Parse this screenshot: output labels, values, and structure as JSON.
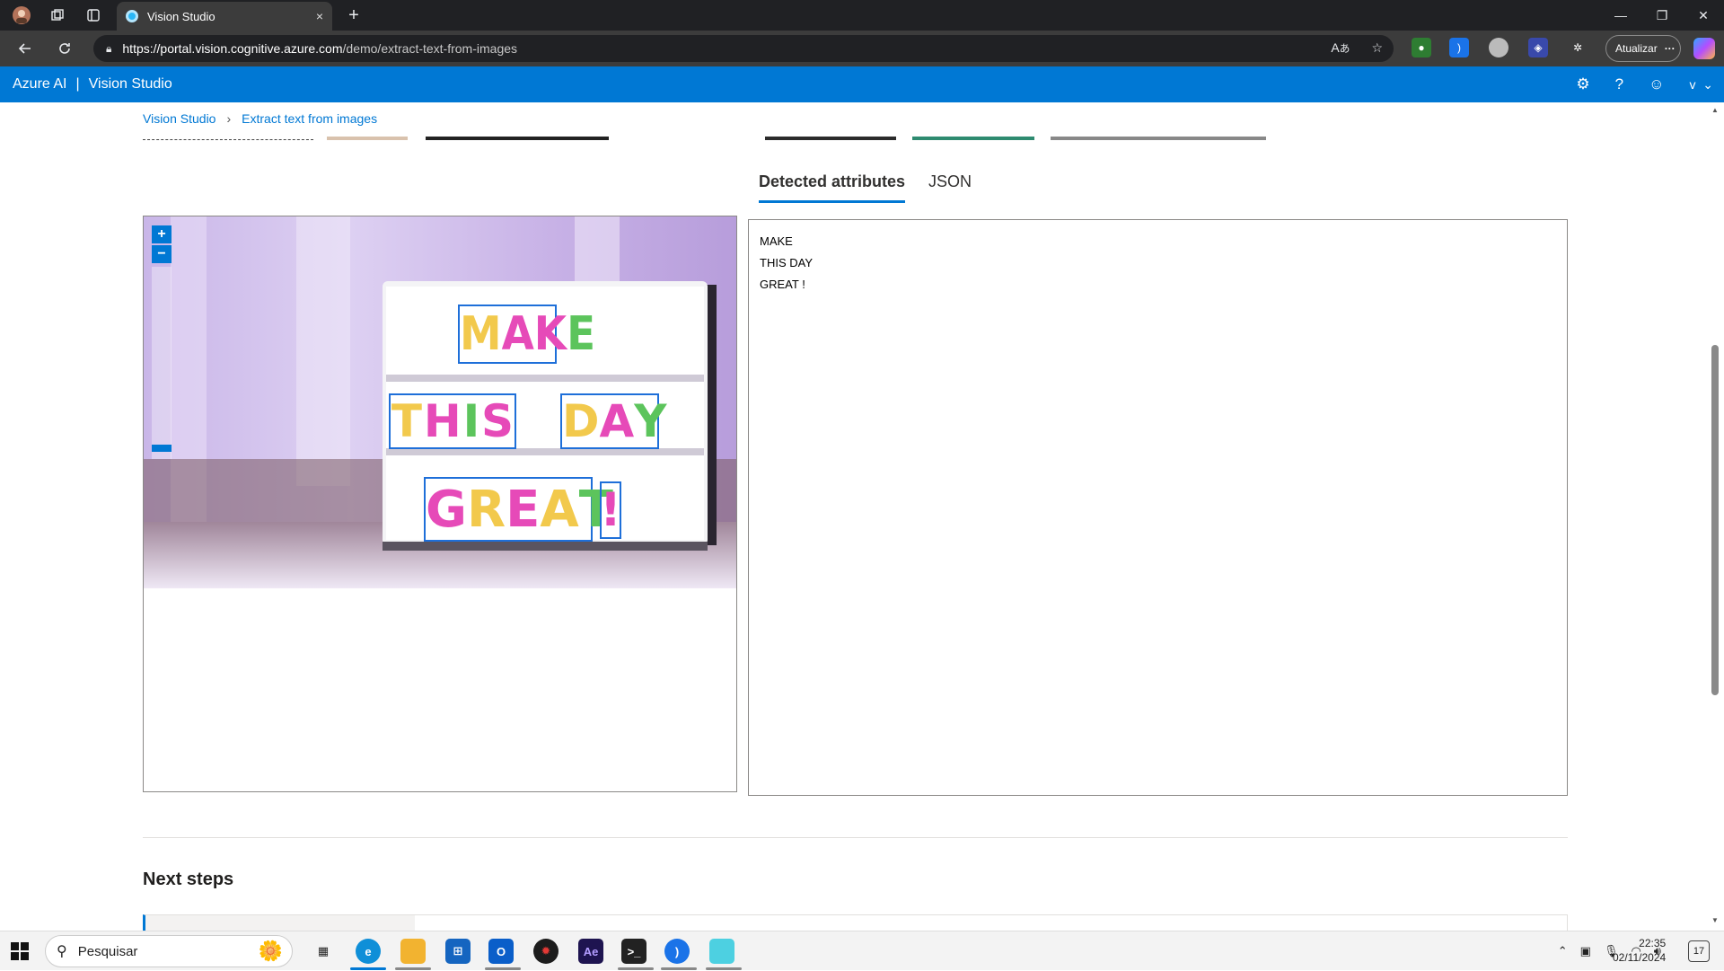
{
  "browser": {
    "tab_title": "Vision Studio",
    "tab_close": "×",
    "new_tab": "+",
    "url_host": "https://portal.vision.cognitive.azure.com",
    "url_path": "/demo/extract-text-from-images",
    "update_label": "Atualizar",
    "update_dots": "···"
  },
  "app": {
    "brand_left": "Azure AI",
    "brand_sep": "|",
    "brand_right": "Vision Studio",
    "user_initial": "v"
  },
  "breadcrumb": {
    "root": "Vision Studio",
    "sep": "›",
    "current": "Extract text from images"
  },
  "tabs": [
    "Detected attributes",
    "JSON"
  ],
  "zoom": {
    "in": "+",
    "out": "−"
  },
  "sign_words": {
    "line1": [
      "M",
      "A",
      "K",
      "E"
    ],
    "line2a": [
      "T",
      "H",
      "I",
      "S"
    ],
    "line2b": [
      "D",
      "A",
      "Y"
    ],
    "line3": [
      "G",
      "R",
      "E",
      "A",
      "T"
    ],
    "bang": "!"
  },
  "detected_lines": [
    "MAKE",
    "THIS DAY",
    "GREAT !"
  ],
  "next_steps_title": "Next steps",
  "taskbar": {
    "search_placeholder": "Pesquisar",
    "time": "22:35",
    "date": "02/11/2024",
    "notif_count": "17"
  },
  "icons": {
    "back": "back-arrow-icon",
    "refresh": "refresh-icon",
    "lock": "lock-icon",
    "settings": "gear-icon",
    "help": "help-icon",
    "feedback": "smiley-icon"
  },
  "colors": {
    "accent": "#0078d4",
    "box": "#1e6fd9",
    "letter_yellow": "#f2c94c",
    "letter_pink": "#e64ab8",
    "letter_green": "#5cc45c"
  }
}
